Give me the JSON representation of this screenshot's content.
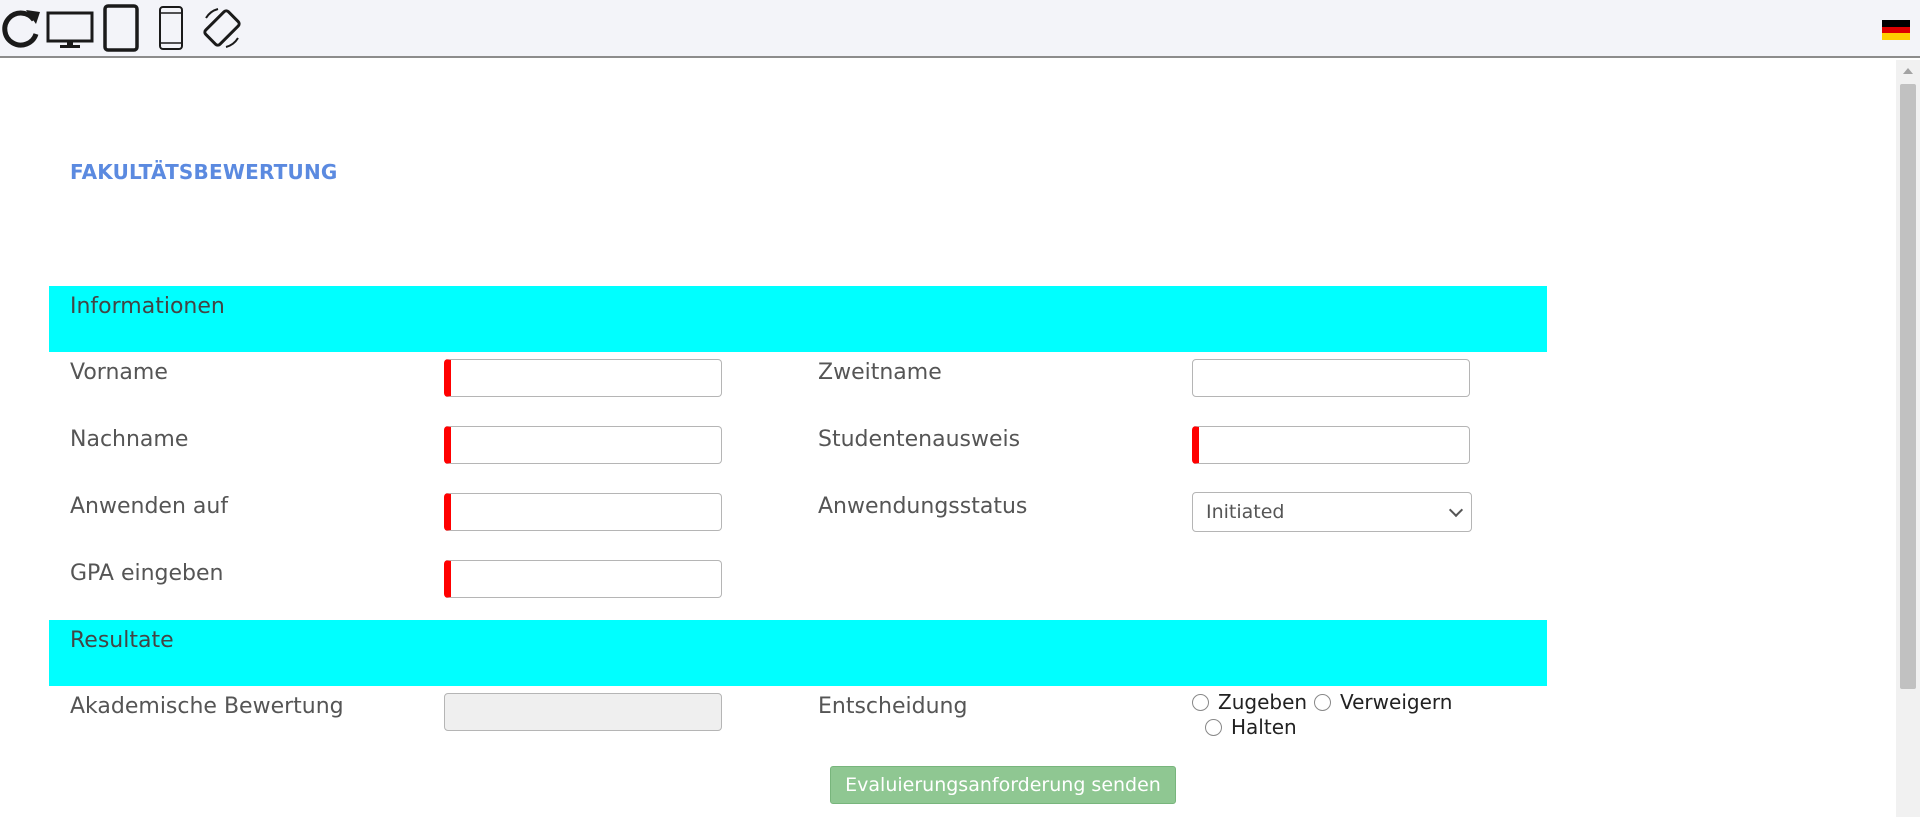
{
  "toolbar": {
    "icons": [
      "refresh-icon",
      "desktop-icon",
      "tablet-icon",
      "phone-icon",
      "rotate-icon"
    ],
    "language_flag": "german-flag-icon",
    "flag_colors": [
      "#000000",
      "#dd0000",
      "#ffce00"
    ]
  },
  "form": {
    "title": "FAKULTÄTSBEWERTUNG",
    "sections": {
      "info": {
        "title": "Informationen"
      },
      "results": {
        "title": "Resultate"
      }
    },
    "fields": {
      "first_name": {
        "label": "Vorname",
        "value": ""
      },
      "middle_name": {
        "label": "Zweitname",
        "value": ""
      },
      "last_name": {
        "label": "Nachname",
        "value": ""
      },
      "student_id": {
        "label": "Studentenausweis",
        "value": ""
      },
      "apply_to": {
        "label": "Anwenden auf",
        "value": ""
      },
      "application_status": {
        "label": "Anwendungsstatus",
        "selected": "Initiated"
      },
      "gpa": {
        "label": "GPA eingeben",
        "value": ""
      },
      "academic_rating": {
        "label": "Akademische Bewertung",
        "value": ""
      },
      "decision": {
        "label": "Entscheidung",
        "options": [
          "Zugeben",
          "Verweigern",
          "Halten"
        ]
      }
    },
    "submit_label": "Evaluierungsanforderung senden"
  },
  "colors": {
    "section_band": "#00ffff",
    "title": "#5b8ae0",
    "required_marker": "#ff0000",
    "submit_button": "#8fc792"
  }
}
